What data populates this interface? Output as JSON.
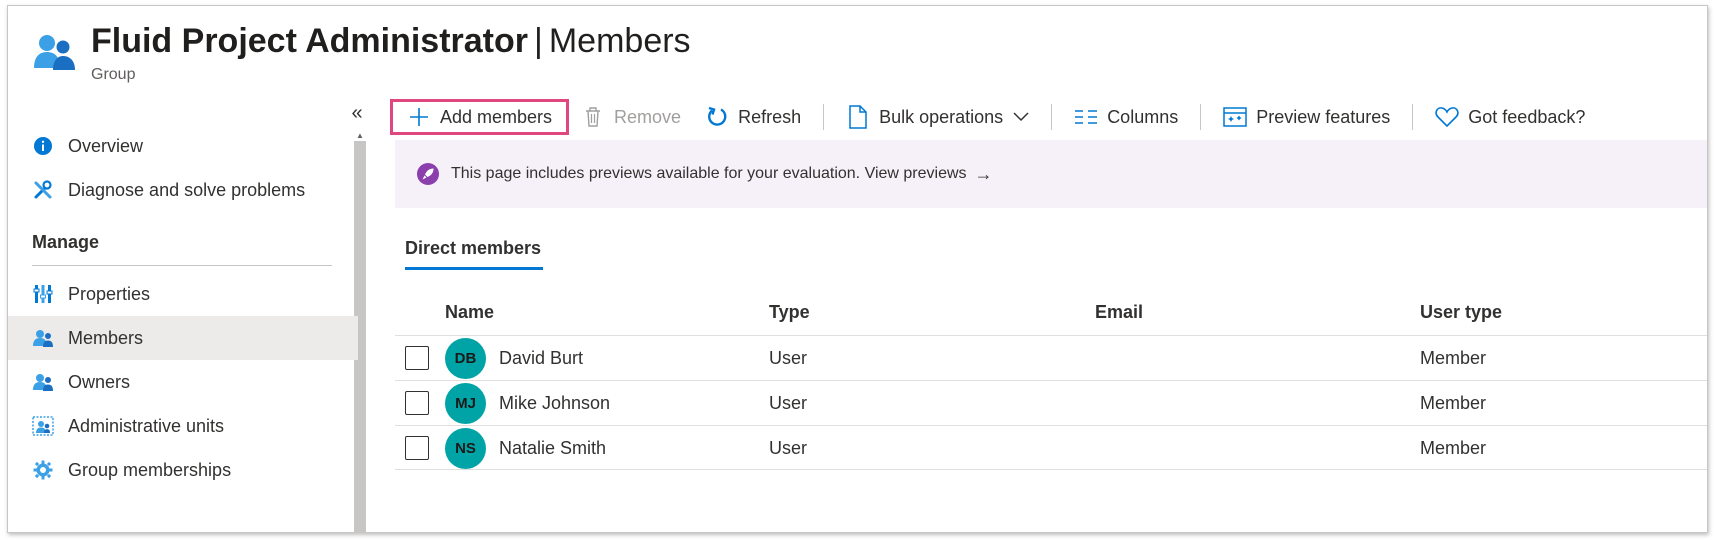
{
  "header": {
    "title_bold": "Fluid Project Administrator",
    "title_sep": "|",
    "title_page": "Members",
    "subtitle": "Group",
    "icon": "group-users-icon"
  },
  "sidebar": {
    "collapse_glyph": "«",
    "items_top": [
      {
        "label": "Overview",
        "icon": "info-icon"
      },
      {
        "label": "Diagnose and solve problems",
        "icon": "wrench-icon"
      }
    ],
    "section_label": "Manage",
    "items_manage": [
      {
        "label": "Properties",
        "icon": "properties-icon"
      },
      {
        "label": "Members",
        "icon": "members-icon",
        "active": true
      },
      {
        "label": "Owners",
        "icon": "owners-icon"
      },
      {
        "label": "Administrative units",
        "icon": "admin-units-icon"
      },
      {
        "label": "Group memberships",
        "icon": "gear-icon"
      }
    ]
  },
  "toolbar": {
    "add_members": "Add members",
    "remove": "Remove",
    "refresh": "Refresh",
    "bulk_operations": "Bulk operations",
    "columns": "Columns",
    "preview_features": "Preview features",
    "feedback": "Got feedback?"
  },
  "banner": {
    "text": "This page includes previews available for your evaluation. View previews",
    "arrow": "→"
  },
  "tabs": [
    {
      "label": "Direct members",
      "active": true
    }
  ],
  "table": {
    "columns": [
      "Name",
      "Type",
      "Email",
      "User type"
    ],
    "rows": [
      {
        "initials": "DB",
        "name": "David Burt",
        "type": "User",
        "email": "",
        "user_type": "Member"
      },
      {
        "initials": "MJ",
        "name": "Mike Johnson",
        "type": "User",
        "email": "",
        "user_type": "Member"
      },
      {
        "initials": "NS",
        "name": "Natalie Smith",
        "type": "User",
        "email": "",
        "user_type": "Member"
      }
    ]
  },
  "colors": {
    "accent": "#0078d4",
    "highlight_border": "#e1477f",
    "avatar": "#00a4a6",
    "banner_bg": "#f6f0f8",
    "active_nav_bg": "#edebe9"
  }
}
